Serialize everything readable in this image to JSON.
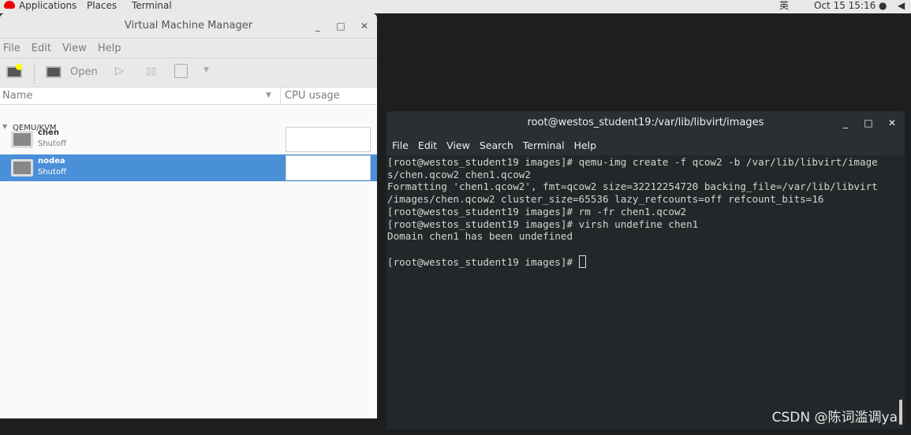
{
  "topbar": {
    "applications": "Applications",
    "places": "Places",
    "terminal": "Terminal",
    "input_method": "英",
    "datetime": "Oct 15  15:16 ●",
    "volume_icon": "speaker-icon"
  },
  "vmm": {
    "title": "Virtual Machine Manager",
    "menu": [
      "File",
      "Edit",
      "View",
      "Help"
    ],
    "toolbar": {
      "open": "Open"
    },
    "columns": {
      "name": "Name",
      "cpu": "CPU usage"
    },
    "group": "QEMU/KVM",
    "vms": [
      {
        "name": "chen",
        "status": "Shutoff"
      },
      {
        "name": "nodea",
        "status": "Shutoff",
        "selected": true
      }
    ],
    "selection_color": "#4a90d9"
  },
  "terminal": {
    "title": "root@westos_student19:/var/lib/libvirt/images",
    "menu": [
      "File",
      "Edit",
      "View",
      "Search",
      "Terminal",
      "Help"
    ],
    "lines": [
      "[root@westos_student19 images]# qemu-img create -f qcow2 -b /var/lib/libvirt/image",
      "s/chen.qcow2 chen1.qcow2",
      "Formatting 'chen1.qcow2', fmt=qcow2 size=32212254720 backing_file=/var/lib/libvirt",
      "/images/chen.qcow2 cluster_size=65536 lazy_refcounts=off refcount_bits=16",
      "[root@westos_student19 images]# rm -fr chen1.qcow2",
      "[root@westos_student19 images]# virsh undefine chen1",
      "Domain chen1 has been undefined",
      ""
    ],
    "prompt": "[root@westos_student19 images]# "
  },
  "watermark": "CSDN @陈词滥调ya"
}
